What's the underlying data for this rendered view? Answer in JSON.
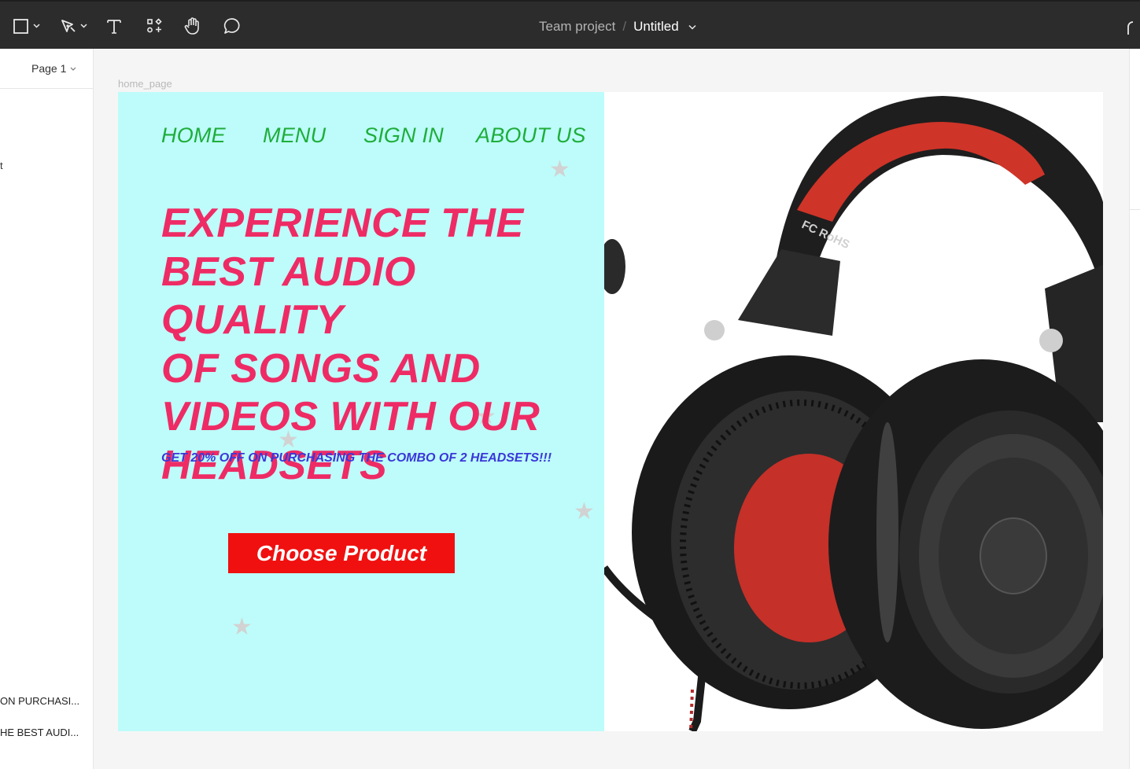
{
  "toolbar": {
    "tools": [
      "frame-tool",
      "pen-tool",
      "text-tool",
      "components-tool",
      "hand-tool",
      "comment-tool"
    ],
    "project": "Team project",
    "separator": "/",
    "document": "Untitled"
  },
  "left_panel": {
    "page_label": "Page 1",
    "stub_text": "t",
    "layers": [
      "ON PURCHASI...",
      "HE BEST AUDI..."
    ]
  },
  "canvas": {
    "frame_label": "home_page"
  },
  "hero": {
    "nav": [
      "HOME",
      "MENU",
      "SIGN IN",
      "ABOUT US"
    ],
    "headline_lines": [
      "EXPERIENCE THE",
      "BEST AUDIO QUALITY",
      "OF SONGS AND",
      "VIDEOS WITH OUR",
      "HEADSETS"
    ],
    "offer": "GET 20% OFF ON PURCHASING THE COMBO OF 2 HEADSETS!!!",
    "cta": "Choose Product",
    "headset_logo_text": "FC RoHS"
  },
  "colors": {
    "hero_bg": "#bdfcfa",
    "nav": "#1fad3a",
    "headline": "#ee2b65",
    "offer": "#3a37d9",
    "cta_bg": "#f01010",
    "toolbar_bg": "#2c2c2c"
  }
}
